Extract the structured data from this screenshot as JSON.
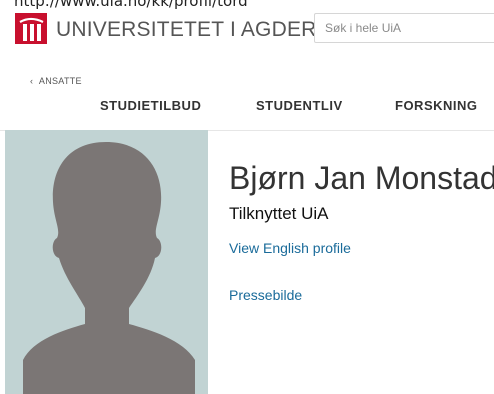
{
  "address_bar": {
    "url_fragment": "http://www.uia.no/kk/profil/tord"
  },
  "header": {
    "logo_text": "UNIVERSITETET I AGDER",
    "search_placeholder": "Søk i hele UiA",
    "breadcrumb": "ANSATTE",
    "nav": [
      "STUDIETILBUD",
      "STUDENTLIV",
      "FORSKNING"
    ]
  },
  "profile": {
    "name": "Bjørn Jan Monstad",
    "affiliation": "Tilknyttet UiA",
    "english_link": "View English profile",
    "press_photo_link": "Pressebilde"
  },
  "colors": {
    "brand": "#c8102e",
    "link": "#1a6b9a",
    "photo_bg": "#c1d3d3",
    "silhouette": "#7b7675"
  }
}
